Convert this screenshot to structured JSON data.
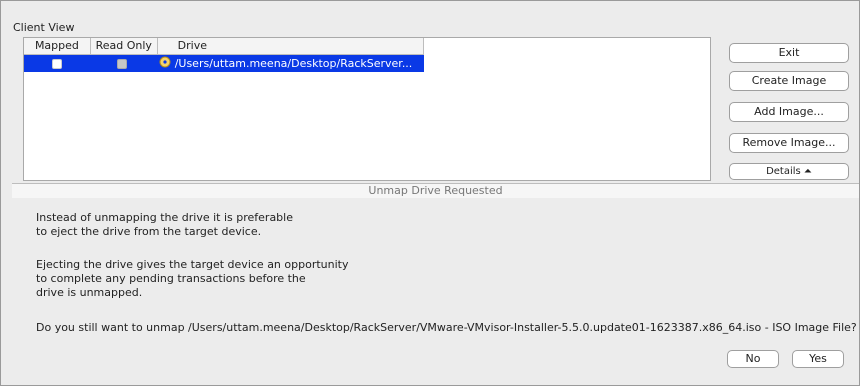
{
  "client_view": {
    "title": "Client View",
    "table": {
      "headers": [
        "Mapped",
        "Read Only",
        "Drive"
      ],
      "rows": [
        {
          "mapped": false,
          "read_only": true,
          "drive": "/Users/uttam.meena/Desktop/RackServer..."
        }
      ]
    }
  },
  "buttons": {
    "exit": "Exit",
    "create_image": "Create Image",
    "add_image": "Add Image...",
    "remove_image": "Remove Image...",
    "details": "Details ⏶"
  },
  "dialog": {
    "title": "Unmap Drive Requested",
    "para1": [
      "Instead of unmapping the drive it is preferable",
      "to eject the drive from the target device."
    ],
    "para2": [
      "Ejecting the drive gives the target device an opportunity",
      "to complete any pending transactions before the",
      "drive is unmapped."
    ],
    "question": "Do you still want to unmap /Users/uttam.meena/Desktop/RackServer/VMware-VMvisor-Installer-5.5.0.update01-1623387.x86_64.iso - ISO Image File?",
    "no": "No",
    "yes": "Yes"
  }
}
